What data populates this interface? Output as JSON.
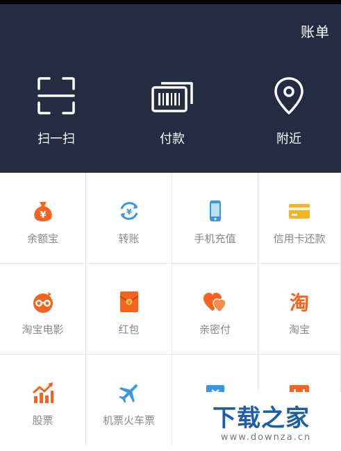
{
  "header": {
    "bill_label": "账单",
    "quick": [
      {
        "label": "扫一扫",
        "icon": "scan-icon"
      },
      {
        "label": "付款",
        "icon": "payment-code-icon"
      },
      {
        "label": "附近",
        "icon": "location-pin-icon"
      }
    ]
  },
  "grid": [
    {
      "label": "余额宝",
      "icon": "yuebao-moneybag-icon",
      "color": "#f5631f"
    },
    {
      "label": "转账",
      "icon": "transfer-icon",
      "color": "#3a95e8"
    },
    {
      "label": "手机充值",
      "icon": "phone-icon",
      "color": "#3a95e8"
    },
    {
      "label": "信用卡还款",
      "icon": "credit-card-icon",
      "color": "#f5b31f"
    },
    {
      "label": "淘宝电影",
      "icon": "movie-glasses-icon",
      "color": "#f5631f"
    },
    {
      "label": "红包",
      "icon": "red-envelope-icon",
      "color": "#f5631f"
    },
    {
      "label": "亲密付",
      "icon": "hearts-icon",
      "color": "#f5631f"
    },
    {
      "label": "淘宝",
      "icon": "taobao-icon",
      "color": "#f5631f"
    },
    {
      "label": "股票",
      "icon": "stock-chart-icon",
      "color": "#f5631f"
    },
    {
      "label": "机票火车票",
      "icon": "airplane-icon",
      "color": "#3a95e8"
    },
    {
      "label": "",
      "icon": "ticket-icon",
      "color": "#3a95e8"
    },
    {
      "label": "",
      "icon": "orange-card-icon",
      "color": "#f5631f"
    }
  ],
  "watermark": {
    "title": "下载之家",
    "url": "www.downza.cn"
  },
  "colors": {
    "header_bg": "#252c41",
    "accent_orange": "#f5631f",
    "accent_blue": "#3a95e8"
  }
}
